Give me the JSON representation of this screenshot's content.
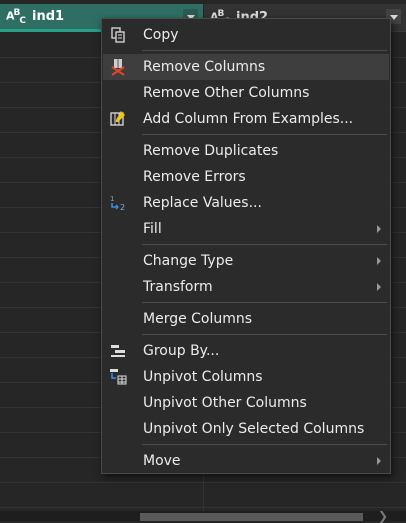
{
  "columns": [
    {
      "type_icon": "ABC",
      "title": "ind1"
    },
    {
      "type_icon": "ABC",
      "title": "ind2"
    }
  ],
  "menu": {
    "items": [
      {
        "label": "Copy",
        "icon": "copy-icon"
      },
      {
        "label": "Remove Columns",
        "icon": "remove-columns-icon"
      },
      {
        "label": "Remove Other Columns"
      },
      {
        "label": "Add Column From Examples...",
        "icon": "add-column-examples-icon"
      },
      {
        "label": "Remove Duplicates"
      },
      {
        "label": "Remove Errors"
      },
      {
        "label": "Replace Values...",
        "icon": "replace-values-icon"
      },
      {
        "label": "Fill",
        "submenu": true
      },
      {
        "label": "Change Type",
        "submenu": true
      },
      {
        "label": "Transform",
        "submenu": true
      },
      {
        "label": "Merge Columns"
      },
      {
        "label": "Group By...",
        "icon": "group-by-icon"
      },
      {
        "label": "Unpivot Columns",
        "icon": "unpivot-icon"
      },
      {
        "label": "Unpivot Other Columns"
      },
      {
        "label": "Unpivot Only Selected Columns"
      },
      {
        "label": "Move",
        "submenu": true
      }
    ],
    "highlighted": "Remove Columns"
  },
  "colors": {
    "selected_header": "#2f6f63",
    "header_accent": "#27a08a",
    "menu_bg": "#2b2b2b",
    "hover_bg": "#3e3e3e"
  }
}
